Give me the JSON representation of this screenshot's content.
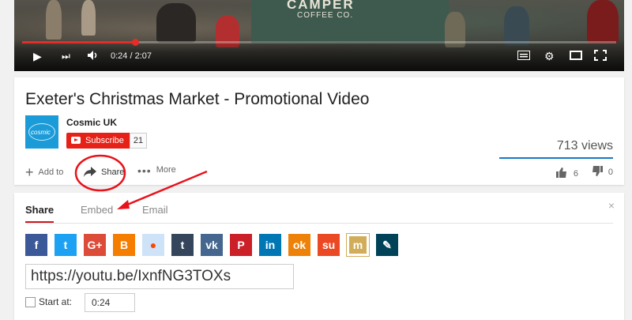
{
  "player": {
    "time": "0:24 / 2:07",
    "progress": 0.19,
    "scene_text_1": "CAMPER",
    "scene_text_2": "COFFEE CO."
  },
  "video": {
    "title": "Exeter's Christmas Market - Promotional Video",
    "channel": "Cosmic UK",
    "logo_text": "cosmic",
    "subscribe_label": "Subscribe",
    "subscriber_count": "21",
    "views": "713 views",
    "actions": {
      "add_to": "Add to",
      "share": "Share",
      "more": "More"
    },
    "likes": "6",
    "dislikes": "0"
  },
  "share_panel": {
    "tabs": [
      "Share",
      "Embed",
      "Email"
    ],
    "close_glyph": "×",
    "social": [
      {
        "name": "facebook",
        "glyph": "f",
        "color": "#3b5998"
      },
      {
        "name": "twitter",
        "glyph": "t",
        "color": "#1da1f2"
      },
      {
        "name": "google-plus",
        "glyph": "G+",
        "color": "#dd4b39"
      },
      {
        "name": "blogger",
        "glyph": "B",
        "color": "#f57d00"
      },
      {
        "name": "reddit",
        "glyph": "●",
        "color": "#cee3f8"
      },
      {
        "name": "tumblr",
        "glyph": "t",
        "color": "#35465c"
      },
      {
        "name": "vk",
        "glyph": "vk",
        "color": "#45668e"
      },
      {
        "name": "pinterest",
        "glyph": "P",
        "color": "#cb2027"
      },
      {
        "name": "linkedin",
        "glyph": "in",
        "color": "#0077b5"
      },
      {
        "name": "odnoklassniki",
        "glyph": "ok",
        "color": "#ee8208"
      },
      {
        "name": "stumbleupon",
        "glyph": "su",
        "color": "#eb4924"
      },
      {
        "name": "mixi",
        "glyph": "m",
        "color": "#d1ad5a"
      },
      {
        "name": "livejournal",
        "glyph": "✎",
        "color": "#004359"
      }
    ],
    "url": "https://youtu.be/IxnfNG3TOXs",
    "start_at_label": "Start at:",
    "start_at_value": "0:24"
  },
  "colors": {
    "accent_red": "#e62117",
    "annotation_red": "#e8121a",
    "views_bar": "#167ac6"
  }
}
